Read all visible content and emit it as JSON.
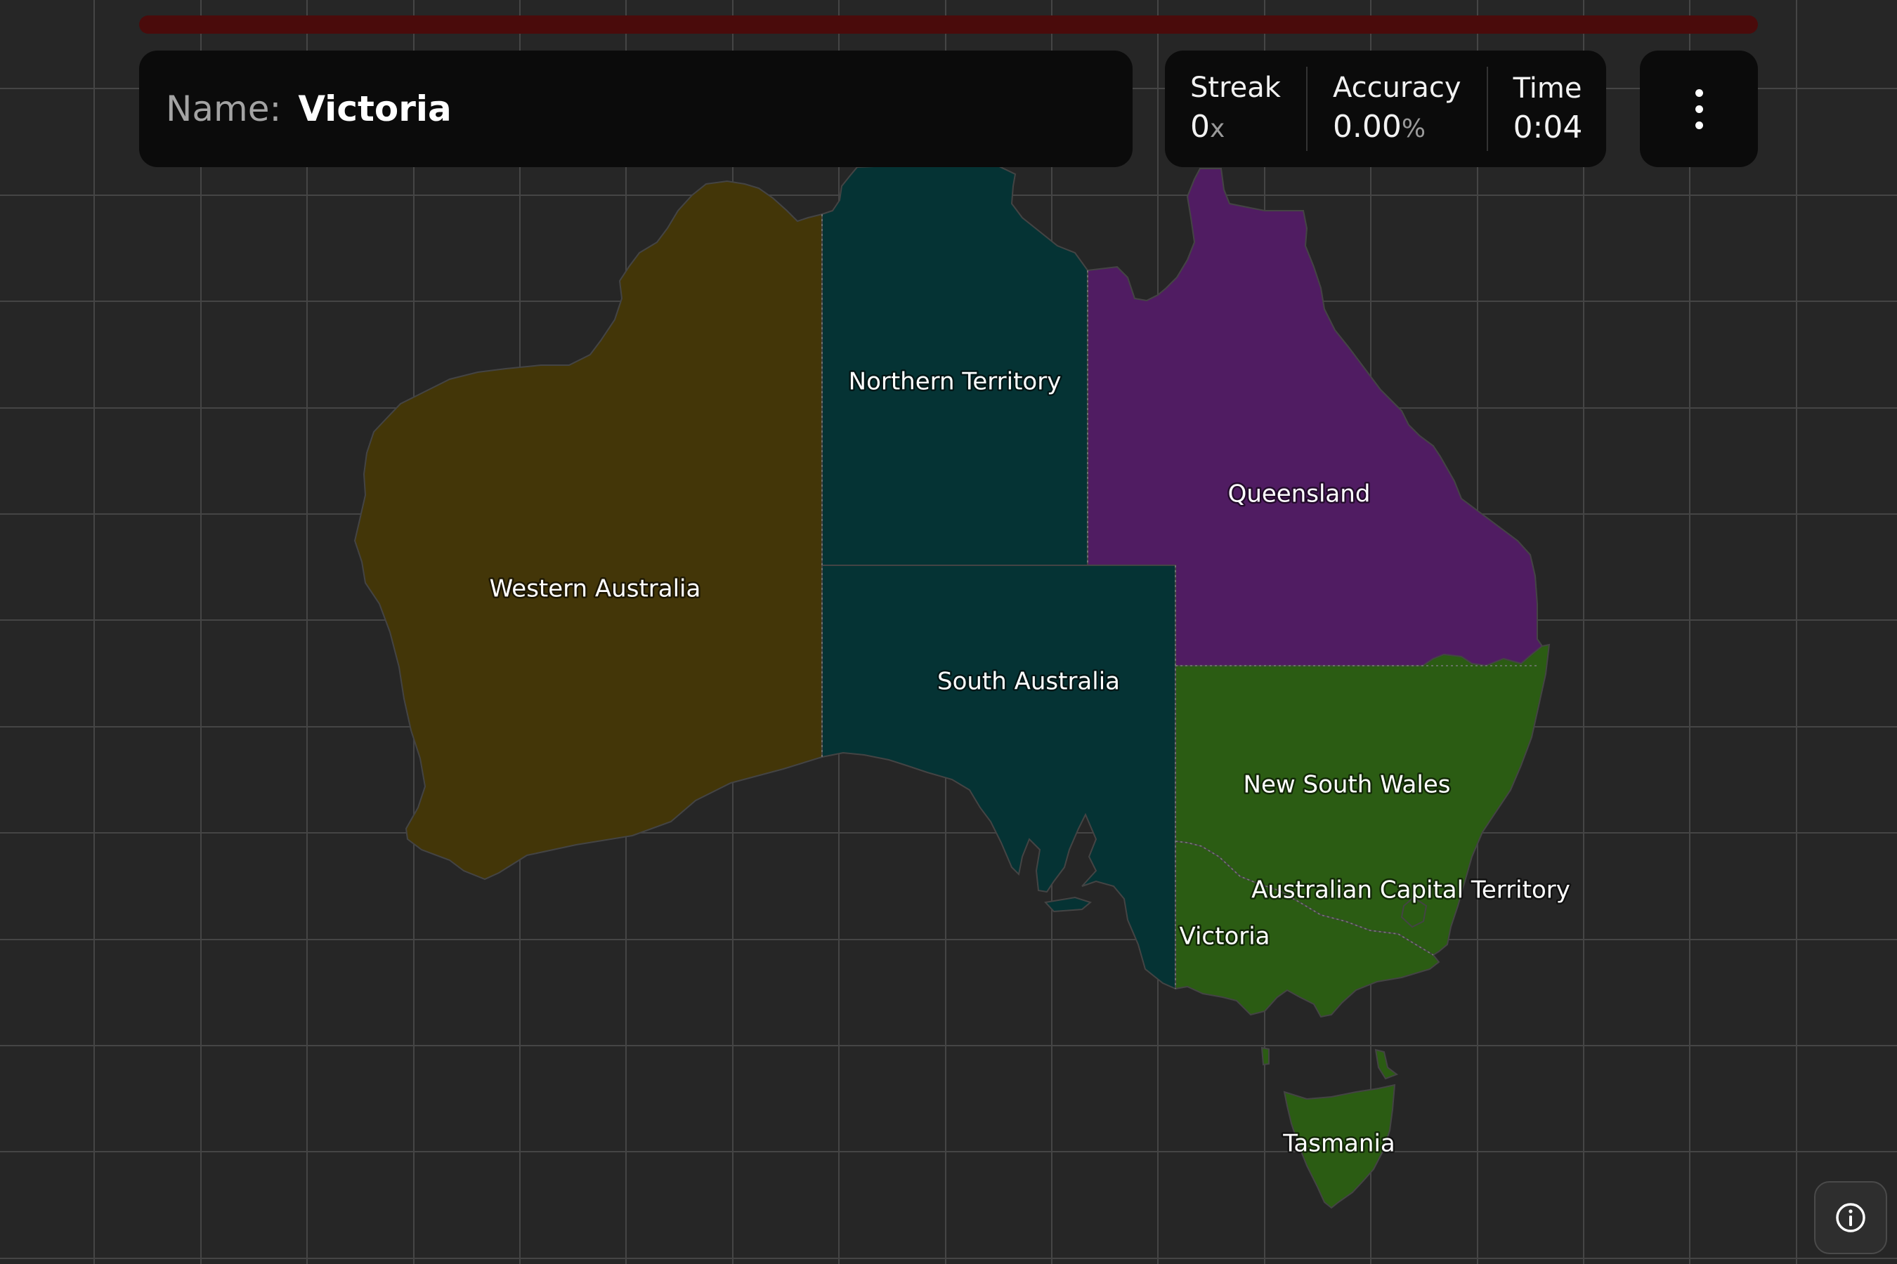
{
  "progress": {
    "fraction": 0.0,
    "track_color": "#4a0b0b",
    "fill_color": "#b01717"
  },
  "prompt": {
    "label": "Name:",
    "value": "Victoria"
  },
  "stats": {
    "streak": {
      "label": "Streak",
      "value": "0",
      "unit": "x"
    },
    "accuracy": {
      "label": "Accuracy",
      "value": "0.00",
      "unit": "%"
    },
    "time": {
      "label": "Time",
      "value": "0:04"
    }
  },
  "menu_icon": "vertical-ellipsis-icon",
  "info_icon": "info-circle-icon",
  "map": {
    "regions": {
      "western_australia": {
        "label": "Western Australia",
        "color": "#433608"
      },
      "northern_territory": {
        "label": "Northern Territory",
        "color": "#053334"
      },
      "south_australia": {
        "label": "South Australia",
        "color": "#053334"
      },
      "queensland": {
        "label": "Queensland",
        "color": "#501c62"
      },
      "new_south_wales": {
        "label": "New South Wales",
        "color": "#2b5c13"
      },
      "australian_capital_territory": {
        "label": "Australian Capital Territory",
        "color": "#2b5c13"
      },
      "victoria": {
        "label": "Victoria",
        "color": "#2b5c13"
      },
      "tasmania": {
        "label": "Tasmania",
        "color": "#2b5c13"
      }
    }
  }
}
